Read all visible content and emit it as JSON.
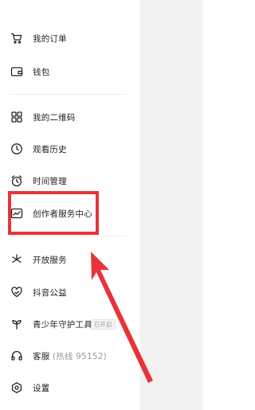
{
  "menu": {
    "items": [
      {
        "label": "我的订单",
        "icon": "cart-icon"
      },
      {
        "label": "钱包",
        "icon": "wallet-icon"
      },
      {
        "label": "我的二维码",
        "icon": "qrcode-icon"
      },
      {
        "label": "观看历史",
        "icon": "clock-icon"
      },
      {
        "label": "时间管理",
        "icon": "alarm-icon"
      },
      {
        "label": "创作者服务中心",
        "icon": "chart-icon"
      },
      {
        "label": "开放服务",
        "icon": "asterisk-icon"
      },
      {
        "label": "抖音公益",
        "icon": "heart-hand-icon"
      },
      {
        "label": "青少年守护工具",
        "icon": "sprout-icon",
        "badge": "已开启"
      },
      {
        "label": "客服",
        "label_suffix": "(热线 95152)",
        "icon": "headset-icon"
      },
      {
        "label": "设置",
        "icon": "gear-icon"
      }
    ]
  },
  "annotation": {
    "highlight_color": "#e8333a"
  }
}
